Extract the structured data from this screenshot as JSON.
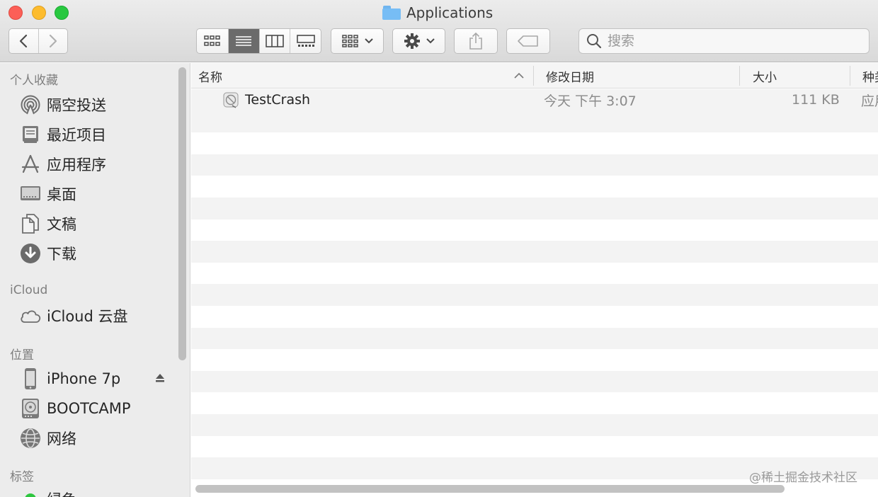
{
  "window": {
    "title": "Applications"
  },
  "toolbar": {
    "search_placeholder": "搜索"
  },
  "sidebar": {
    "favorites_title": "个人收藏",
    "favorites": [
      {
        "label": "隔空投送",
        "icon": "airdrop-icon"
      },
      {
        "label": "最近项目",
        "icon": "recents-icon"
      },
      {
        "label": "应用程序",
        "icon": "applications-icon"
      },
      {
        "label": "桌面",
        "icon": "desktop-icon"
      },
      {
        "label": "文稿",
        "icon": "documents-icon"
      },
      {
        "label": "下载",
        "icon": "downloads-icon"
      }
    ],
    "icloud_title": "iCloud",
    "icloud": [
      {
        "label": "iCloud 云盘",
        "icon": "icloud-drive-icon"
      }
    ],
    "locations_title": "位置",
    "locations": [
      {
        "label": "iPhone 7p",
        "icon": "iphone-icon"
      },
      {
        "label": "BOOTCAMP",
        "icon": "disk-icon"
      },
      {
        "label": "网络",
        "icon": "network-icon"
      }
    ],
    "tags_title": "标签",
    "tags": [
      {
        "label": "绿色",
        "color": "#2ec63f"
      }
    ]
  },
  "table": {
    "columns": [
      "名称",
      "修改日期",
      "大小",
      "种类"
    ],
    "files": [
      {
        "name": "TestCrash",
        "modified": "今天 下午 3:07",
        "size": "111 KB",
        "kind": "应用程序"
      }
    ]
  },
  "watermark": "@稀土掘金技术社区"
}
